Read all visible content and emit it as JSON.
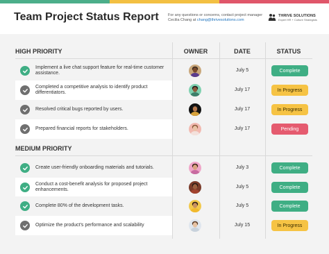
{
  "header": {
    "title": "Team Project Status Report",
    "contact_line1": "For any questions or concerns, contact project manager",
    "contact_line2_prefix": "Cecilia Chang at ",
    "contact_email": "chang@thrivesolutions.com",
    "logo_name": "THRIVE SOLUTIONS",
    "logo_tagline": "Expert HR + Culture Strategists"
  },
  "topbar_colors": [
    "#4cae8a",
    "#f3c043",
    "#e0566a"
  ],
  "columns": {
    "owner": "OWNER",
    "date": "DATE",
    "status": "STATUS"
  },
  "status_colors": {
    "Complete": {
      "bg": "#3fae84",
      "fg": "#ffffff"
    },
    "In Progress": {
      "bg": "#f6c344",
      "fg": "#3a2d00"
    },
    "Pending": {
      "bg": "#e55b6f",
      "fg": "#ffffff"
    }
  },
  "check_colors": {
    "done": "#3fae84",
    "open": "#6f6f6f"
  },
  "sections": [
    {
      "title": "HIGH PRIORITY",
      "tasks": [
        {
          "text": "Implement a live chat support feature for real-time customer assistance.",
          "check": "done",
          "avatar": "avatar-1",
          "date": "July 5",
          "status": "Complete"
        },
        {
          "text": "Completed a competitive analysis to identify product differentiators.",
          "check": "open",
          "avatar": "avatar-2",
          "date": "July 17",
          "status": "In Progress"
        },
        {
          "text": "Resolved critical bugs reported by users.",
          "check": "open",
          "avatar": "avatar-3",
          "date": "July 17",
          "status": "In Progress"
        },
        {
          "text": "Prepared financial reports for stakeholders.",
          "check": "open",
          "avatar": "avatar-4",
          "date": "July 17",
          "status": "Pending"
        }
      ]
    },
    {
      "title": "MEDIUM  PRIORITY",
      "tasks": [
        {
          "text": "Create user-friendly onboarding materials and tutorials.",
          "check": "done",
          "avatar": "avatar-5",
          "date": "July 3",
          "status": "Complete"
        },
        {
          "text": "Conduct a cost-benefit analysis for proposed project enhancements.",
          "check": "done",
          "avatar": "avatar-6",
          "date": "July 5",
          "status": "Complete"
        },
        {
          "text": "Complete 80% of the development tasks.",
          "check": "done",
          "avatar": "avatar-7",
          "date": "July 5",
          "status": "Complete"
        },
        {
          "text": "Optimize the product's performance and scalability",
          "check": "open",
          "avatar": "avatar-8",
          "date": "July 15",
          "status": "In Progress"
        }
      ]
    }
  ]
}
